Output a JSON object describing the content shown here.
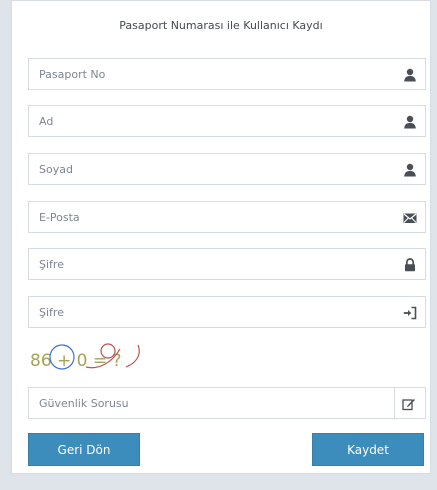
{
  "form": {
    "title": "Pasaport Numarası ile Kullanıcı Kaydı",
    "fields": [
      {
        "placeholder": "Pasaport No",
        "icon": "user-icon"
      },
      {
        "placeholder": "Ad",
        "icon": "user-icon"
      },
      {
        "placeholder": "Soyad",
        "icon": "user-icon"
      },
      {
        "placeholder": "E-Posta",
        "icon": "envelope-icon"
      },
      {
        "placeholder": "Şifre",
        "icon": "lock-icon"
      },
      {
        "placeholder": "Şifre",
        "icon": "sign-in-icon"
      }
    ],
    "captcha": {
      "text": "86 + 0 = ?"
    },
    "security": {
      "placeholder": "Güvenlik Sorusu",
      "icon": "edit-icon"
    },
    "buttons": {
      "back": "Geri Dön",
      "save": "Kaydet"
    }
  },
  "colors": {
    "accent": "#3c8dbc",
    "background": "#dfe3ea"
  }
}
